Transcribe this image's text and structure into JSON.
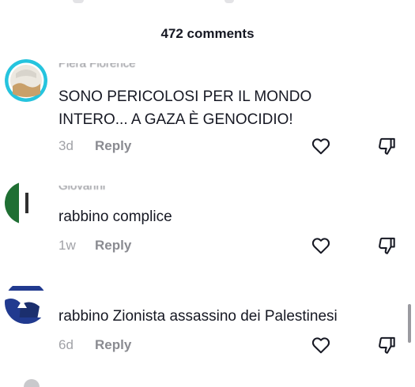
{
  "header": {
    "title": "472 comments"
  },
  "comments": [
    {
      "username": "Piera Florence",
      "text": "SONO PERICOLOSI PER IL MONDO\nINTERO... A GAZA È GENOCIDIO!",
      "time": "3d",
      "reply_label": "Reply",
      "like_icon": "heart-outline-icon",
      "dislike_icon": "thumbs-down-outline-icon"
    },
    {
      "username": "Giovanni",
      "text": "rabbino complice",
      "time": "1w",
      "reply_label": "Reply",
      "like_icon": "heart-outline-icon",
      "dislike_icon": "thumbs-down-outline-icon"
    },
    {
      "username": "",
      "text": "rabbino Zionista assassino dei Palestinesi",
      "time": "6d",
      "reply_label": "Reply",
      "like_icon": "heart-outline-icon",
      "dislike_icon": "thumbs-down-outline-icon"
    }
  ],
  "colors": {
    "text_primary": "#161823",
    "text_secondary": "#8a8b91",
    "avatar_ring": "#25c4de",
    "flag_green": "#1f6f33",
    "flag_blue": "#213a8f"
  }
}
